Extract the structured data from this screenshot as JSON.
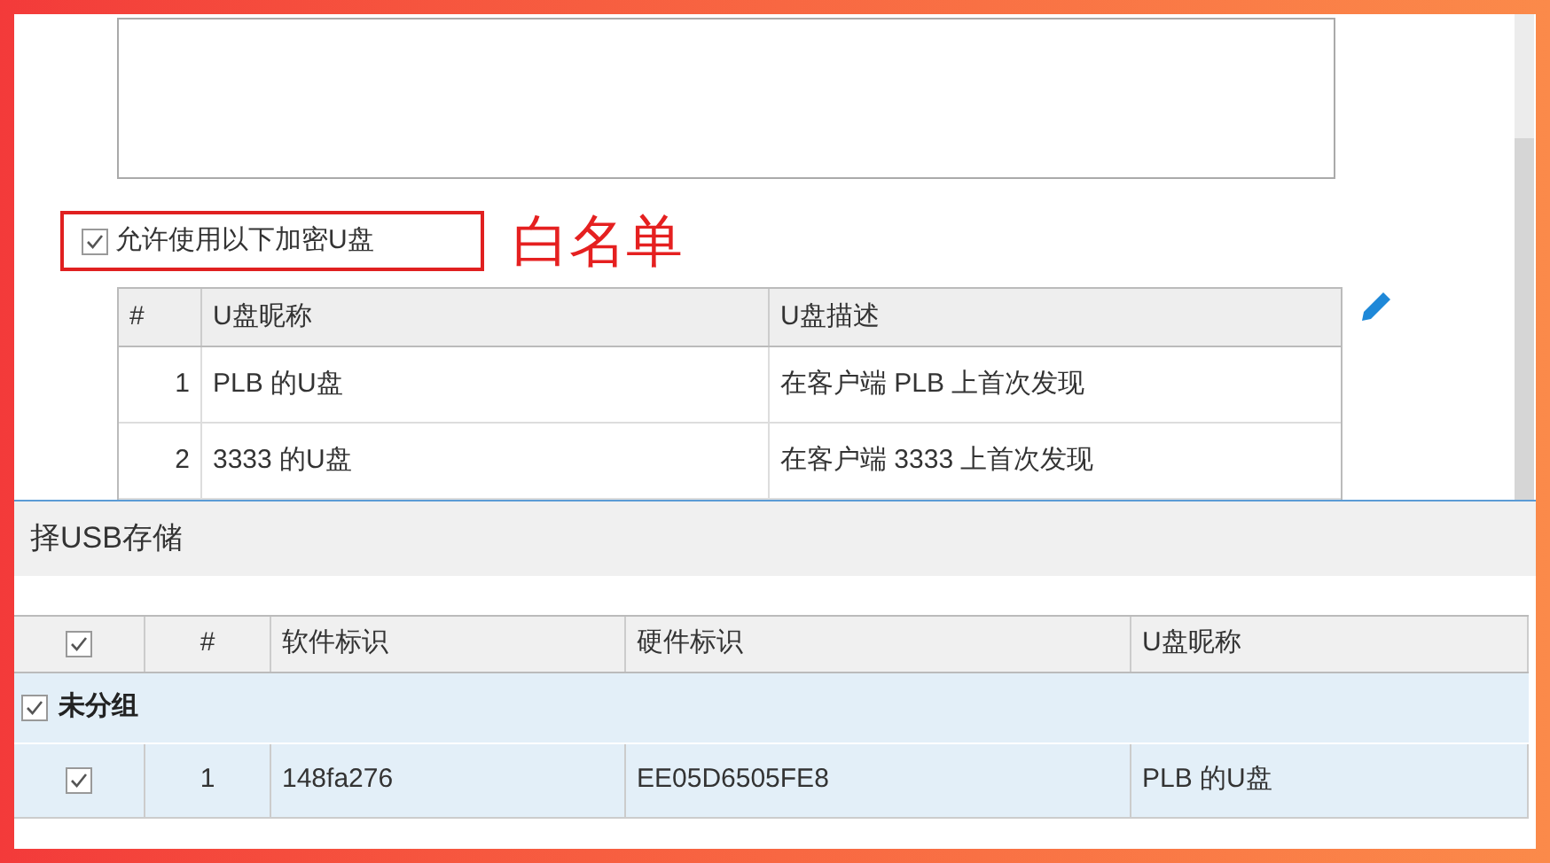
{
  "top_panel": {
    "whitelist_checkbox": {
      "label": "允许使用以下加密U盘",
      "checked": true
    },
    "annotation": "白名单",
    "table": {
      "columns": [
        "#",
        "U盘昵称",
        "U盘描述"
      ],
      "rows": [
        [
          "1",
          "PLB 的U盘",
          "在客户端 PLB 上首次发现"
        ],
        [
          "2",
          "3333 的U盘",
          "在客户端 3333 上首次发现"
        ]
      ]
    }
  },
  "dialog": {
    "title": "择USB存储",
    "table": {
      "header_checked": true,
      "columns": [
        "#",
        "软件标识",
        "硬件标识",
        "U盘昵称"
      ],
      "groups": [
        {
          "label": "未分组",
          "checked": true,
          "rows": [
            {
              "cells": [
                "1",
                "148fa276",
                "EE05D6505FE8",
                "PLB 的U盘"
              ],
              "checked": true
            }
          ]
        }
      ]
    }
  }
}
